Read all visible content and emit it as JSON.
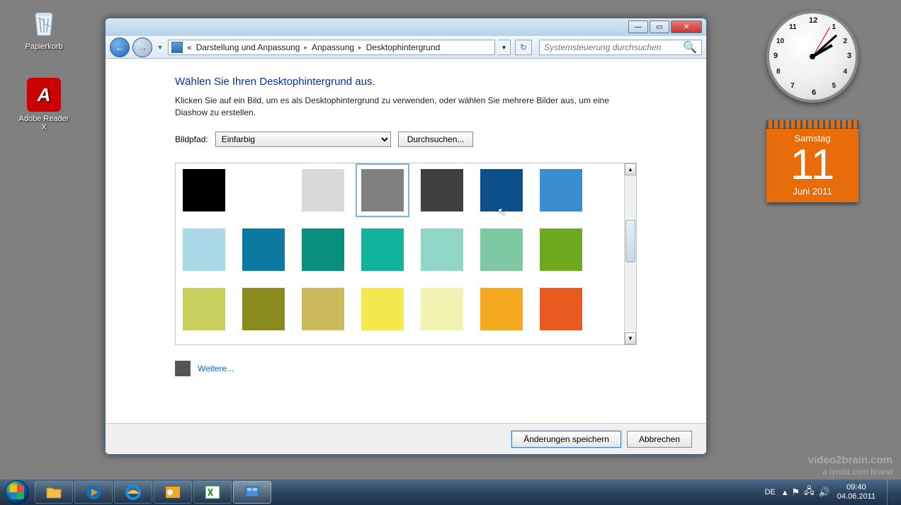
{
  "desktop": {
    "icons": [
      {
        "name": "Papierkorb"
      },
      {
        "name": "Adobe Reader X"
      }
    ]
  },
  "clock_gadget": {
    "hour": 2,
    "minute": 8
  },
  "calendar_gadget": {
    "dow": "Samstag",
    "day": "11",
    "month": "Juni 2011"
  },
  "window": {
    "breadcrumb": {
      "prefix": "«",
      "segments": [
        "Darstellung und Anpassung",
        "Anpassung",
        "Desktophintergrund"
      ]
    },
    "search_placeholder": "Systemsteuerung durchsuchen",
    "heading": "Wählen Sie Ihren Desktophintergrund aus.",
    "subtext": "Klicken Sie auf ein Bild, um es als Desktophintergrund zu verwenden, oder wählen Sie mehrere Bilder aus, um eine Diashow zu erstellen.",
    "path_label": "Bildpfad:",
    "path_value": "Einfarbig",
    "browse_label": "Durchsuchen...",
    "colors": [
      [
        "#000000",
        "#ffffff",
        "#d9d9d9",
        "#808080",
        "#3f3f3f",
        "#0b4f8b",
        "#3c8cd1"
      ],
      [
        "#a9d8e6",
        "#0d78a0",
        "#0a8f7d",
        "#13b29a",
        "#8fd6c7",
        "#7fc9a2",
        "#6ea91f"
      ],
      [
        "#c9cf5c",
        "#8a8a1f",
        "#cbb95c",
        "#f4e94e",
        "#f3f3b1",
        "#f3a81f",
        "#e85a1f"
      ]
    ],
    "partial_colors": [
      "#b84a1f",
      "#8a3a1f",
      "#b03a1f",
      "#c23a3a",
      "#d05a5a",
      "#8a6a5a",
      "#8a2a2a"
    ],
    "selected_index": [
      0,
      3
    ],
    "more_label": "Weitere...",
    "save_label": "Änderungen speichern",
    "cancel_label": "Abbrechen"
  },
  "taskbar": {
    "lang": "DE",
    "time": "09:40",
    "date": "04.06.2011"
  },
  "watermark": {
    "line1": "video2brain.com",
    "line2": "a lynda.com brand"
  }
}
